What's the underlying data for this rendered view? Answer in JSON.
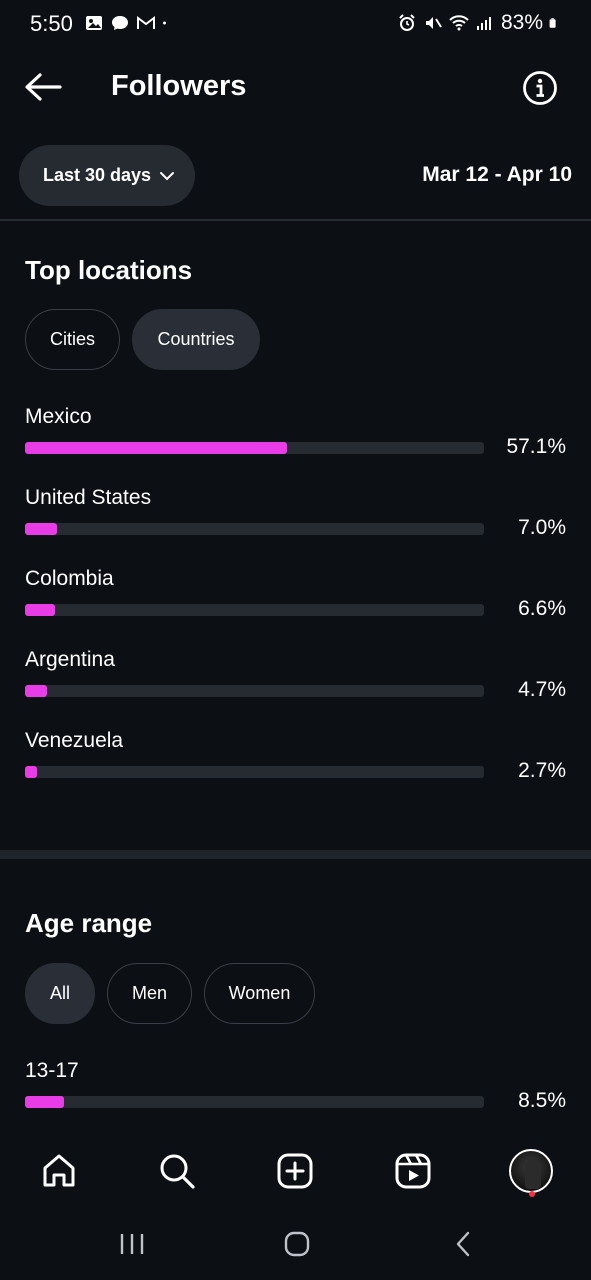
{
  "status_bar": {
    "time": "5:50",
    "battery": "83%"
  },
  "header": {
    "title": "Followers"
  },
  "filters": {
    "range_label": "Last 30 days",
    "date_range": "Mar 12 - Apr 10"
  },
  "top_locations": {
    "title": "Top locations",
    "chips": [
      {
        "label": "Cities",
        "active": false
      },
      {
        "label": "Countries",
        "active": true
      }
    ],
    "items": [
      {
        "name": "Mexico",
        "percent_label": "57.1%",
        "fill_fraction": 0.571
      },
      {
        "name": "United States",
        "percent_label": "7.0%",
        "fill_fraction": 0.07
      },
      {
        "name": "Colombia",
        "percent_label": "6.6%",
        "fill_fraction": 0.066
      },
      {
        "name": "Argentina",
        "percent_label": "4.7%",
        "fill_fraction": 0.047
      },
      {
        "name": "Venezuela",
        "percent_label": "2.7%",
        "fill_fraction": 0.027
      }
    ]
  },
  "age_range": {
    "title": "Age range",
    "chips": [
      {
        "label": "All",
        "active": true
      },
      {
        "label": "Men",
        "active": false
      },
      {
        "label": "Women",
        "active": false
      }
    ],
    "items": [
      {
        "name": "13-17",
        "percent_label": "8.5%",
        "fill_fraction": 0.085
      }
    ]
  },
  "colors": {
    "background": "#0c0f14",
    "bar_fill": "#e83de6",
    "bar_track": "#262a31",
    "chip_active": "#2a2f37",
    "notification_dot": "#ff3040"
  },
  "icons": {
    "nav": [
      "home-icon",
      "search-icon",
      "create-icon",
      "reels-icon",
      "profile-avatar"
    ],
    "system": [
      "recent-apps-icon",
      "home-circle-icon",
      "system-back-icon"
    ]
  }
}
